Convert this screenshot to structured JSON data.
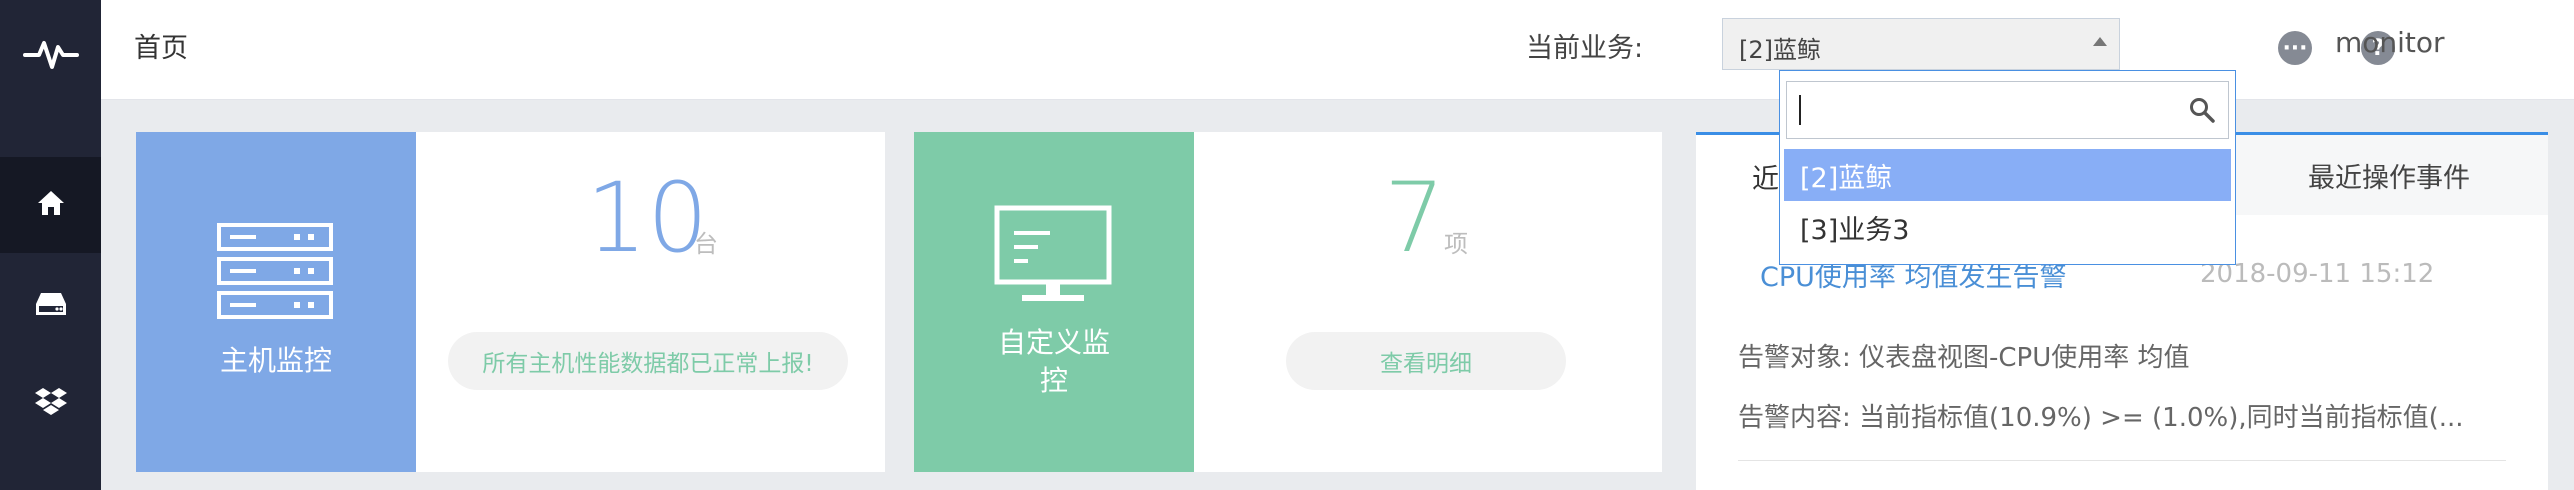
{
  "header": {
    "breadcrumb": "首页",
    "business_label": "当前业务:",
    "business_selected": "[2]蓝鲸",
    "user": "monitor"
  },
  "dropdown": {
    "search_value": "",
    "options": [
      {
        "label": "[2]蓝鲸",
        "selected": true
      },
      {
        "label": "[3]业务3",
        "selected": false
      }
    ]
  },
  "cards": {
    "host": {
      "title": "主机监控",
      "count": "10",
      "unit": "台",
      "status": "所有主机性能数据都已正常上报!"
    },
    "custom": {
      "title_line1": "自定义监",
      "title_line2": "控",
      "count": "7",
      "unit": "项",
      "action": "查看明细"
    }
  },
  "panel": {
    "tab_left": "近",
    "tab_right": "最近操作事件",
    "event_title": "CPU使用率 均值发生告警",
    "event_time": "2018-09-11 15:12",
    "target_line": "告警对象:  仪表盘视图-CPU使用率 均值",
    "content_line": "告警内容:  当前指标值(10.9%) >= (1.0%),同时当前指标值(..."
  },
  "colors": {
    "nav_bg": "#212536",
    "host_accent": "#7fa8e6",
    "custom_accent": "#7ecba8",
    "host_number": "#7fa8e6",
    "custom_number": "#7ecba8",
    "link": "#4a8fd6",
    "selected_option": "#88aef6"
  },
  "icons": [
    "pulse-logo-icon",
    "home-icon",
    "server-tray-icon",
    "dropbox-icon",
    "more-icon",
    "help-icon",
    "server-stack-icon",
    "monitor-icon",
    "search-icon"
  ]
}
